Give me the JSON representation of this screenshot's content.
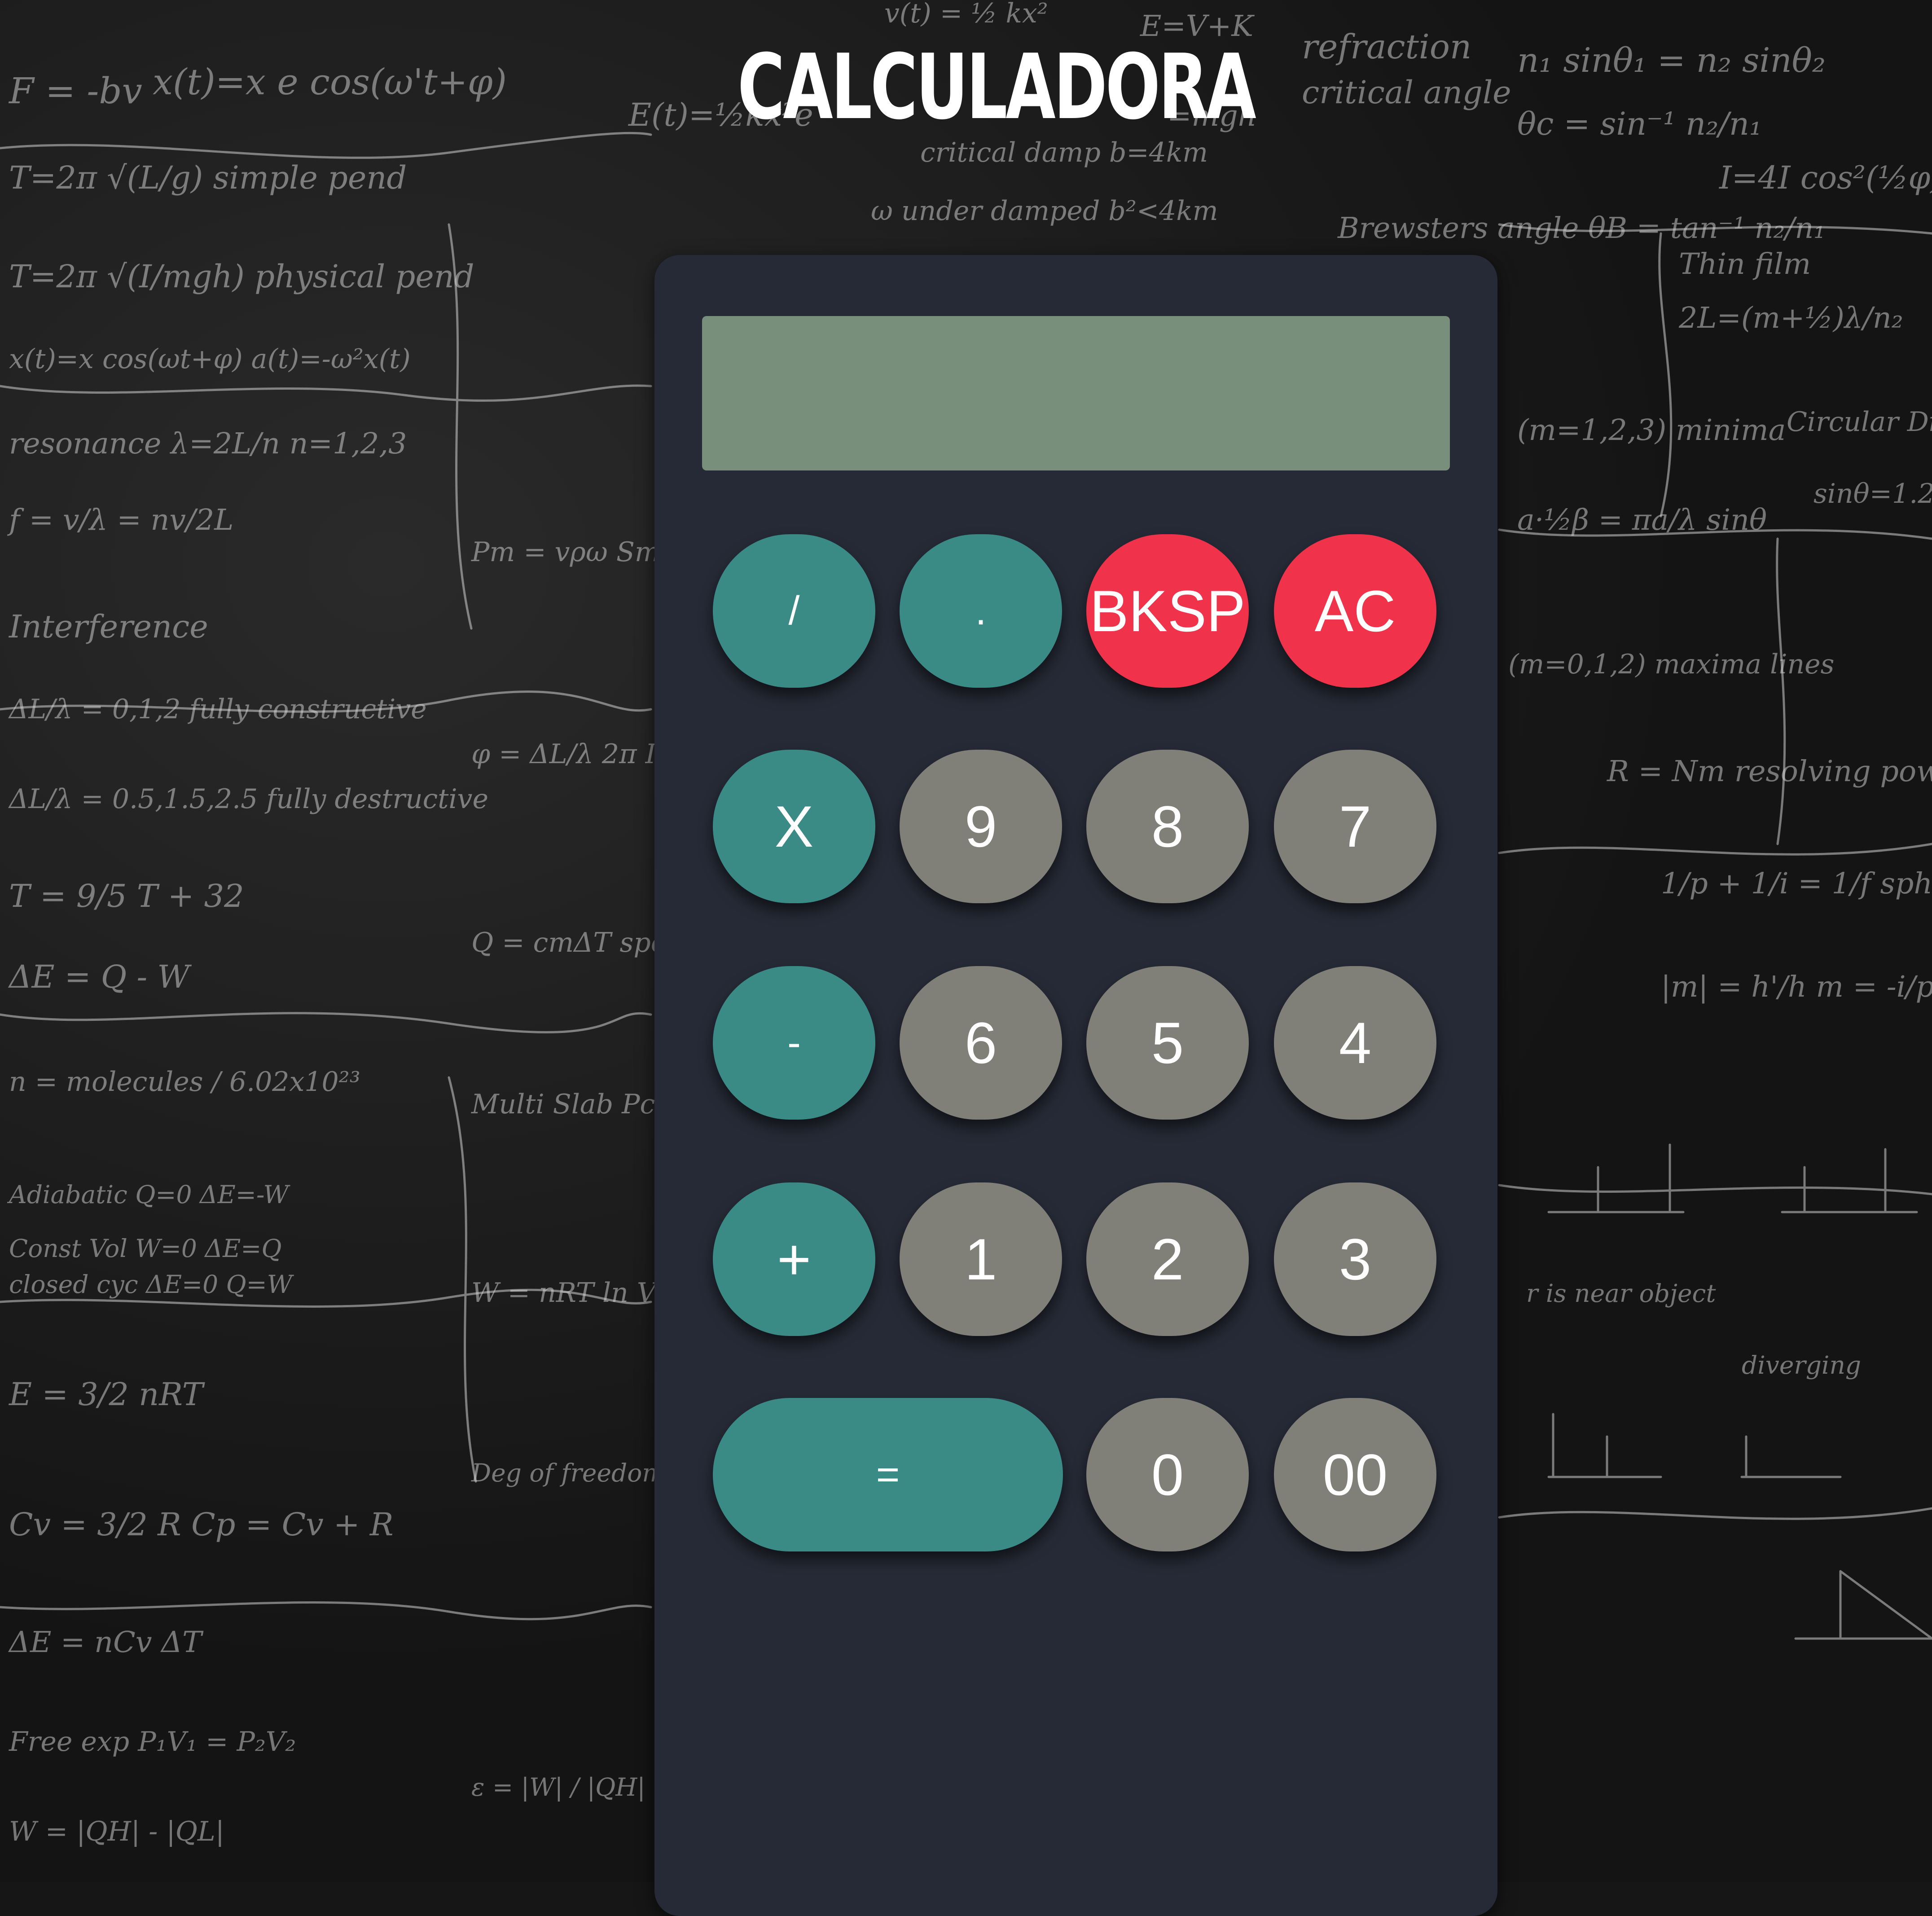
{
  "header": {
    "title": "CALCULADORA"
  },
  "display": {
    "value": ""
  },
  "keypad": {
    "row1": {
      "divide": "/",
      "decimal": ".",
      "backspace": "BKSP",
      "clear": "AC"
    },
    "row2": {
      "multiply": "X",
      "nine": "9",
      "eight": "8",
      "seven": "7"
    },
    "row3": {
      "subtract": "-",
      "six": "6",
      "five": "5",
      "four": "4"
    },
    "row4": {
      "add": "+",
      "one": "1",
      "two": "2",
      "three": "3"
    },
    "row5": {
      "equals": "=",
      "zero": "0",
      "double_zero": "00"
    }
  },
  "colors": {
    "operator": "#3a8a86",
    "number": "#808079",
    "danger": "#f0324a",
    "display": "#78907b",
    "body": "#262a36"
  }
}
